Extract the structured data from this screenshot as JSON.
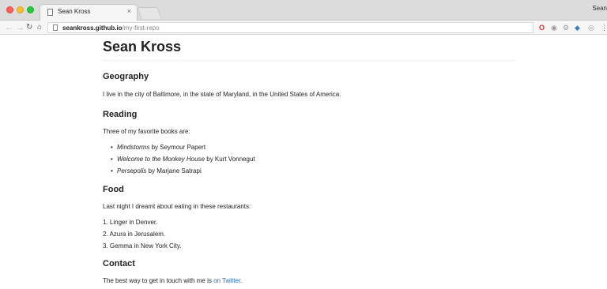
{
  "browser": {
    "tab_title": "Sean Kross",
    "tab_close": "×",
    "profile_label": "Sean",
    "url_host": "seankross.github.io",
    "url_path": "/my-first-repo"
  },
  "page": {
    "title": "Sean Kross",
    "sections": {
      "geography": {
        "heading": "Geography",
        "text": "I live in the city of Baltimore, in the state of Maryland, in the United States of America."
      },
      "reading": {
        "heading": "Reading",
        "intro": "Three of my favorite books are:",
        "books": [
          {
            "title": "Mindstorms",
            "author": " by Seymour Papert"
          },
          {
            "title": "Welcome to the Monkey House",
            "author": " by Kurt Vonnegut"
          },
          {
            "title": "Persepolis",
            "author": " by Marjane Satrapi"
          }
        ]
      },
      "food": {
        "heading": "Food",
        "intro": "Last night I dreamt about eating in these restaurants:",
        "restaurants": [
          "1. Linger in Denver.",
          "2. Azura in Jerusalem.",
          "3. Gemma in New York City."
        ]
      },
      "contact": {
        "heading": "Contact",
        "text_before": "The best way to get in touch with me is ",
        "link_text": "on Twitter",
        "text_after": "."
      }
    }
  },
  "colors": {
    "link": "#1e6bb8",
    "text": "#222222",
    "chrome_bg": "#dcdcdc"
  },
  "icons": [
    "back-arrow-icon",
    "forward-arrow-icon",
    "reload-icon",
    "home-icon",
    "page-icon",
    "opera-icon",
    "menu-icon"
  ]
}
